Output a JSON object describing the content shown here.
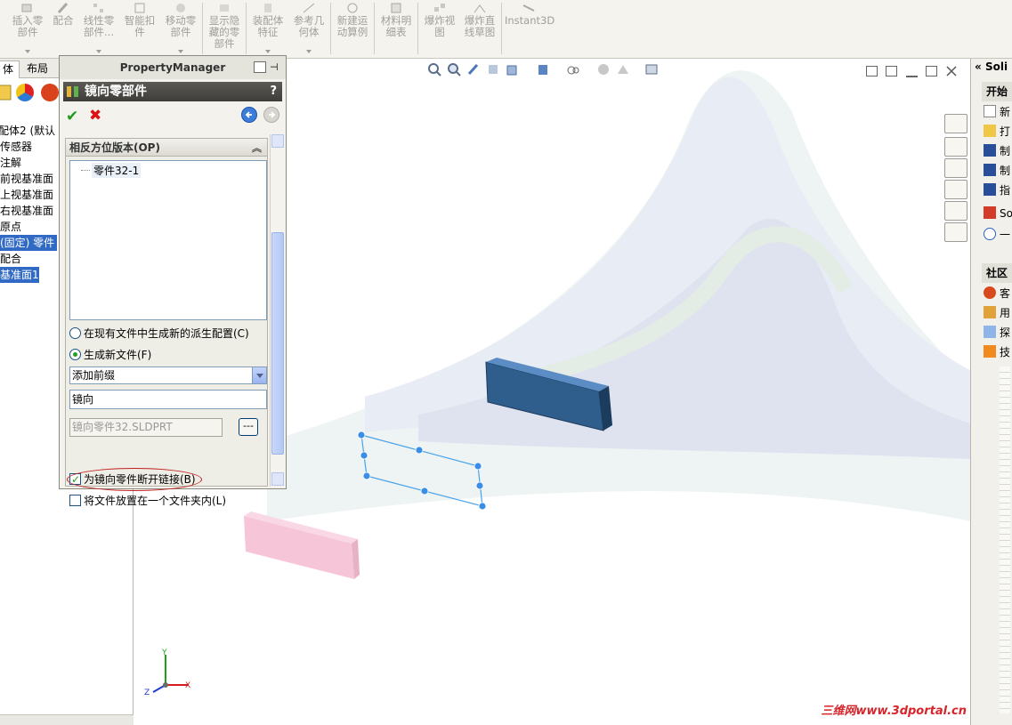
{
  "toolbar": {
    "buttons": [
      {
        "label": "插入零部件"
      },
      {
        "label": "配合"
      },
      {
        "label": "线性零部件..."
      },
      {
        "label": "智能扣件"
      },
      {
        "label": "移动零部件"
      },
      {
        "label": "显示隐藏的零部件"
      },
      {
        "label": "装配体特征"
      },
      {
        "label": "参考几何体"
      },
      {
        "label": "新建运动算例"
      },
      {
        "label": "材料明细表"
      },
      {
        "label": "爆炸视图"
      },
      {
        "label": "爆炸直线草图"
      },
      {
        "label": "Instant3D"
      }
    ]
  },
  "feature_manager": {
    "tabs": [
      "体",
      "布局"
    ],
    "tree": [
      "配体2 (默认",
      "传感器",
      "注解",
      "前视基准面",
      "上视基准面",
      "右视基准面",
      "原点",
      "(固定) 零件",
      "配合",
      "基准面1"
    ]
  },
  "property_manager": {
    "header": "PropertyManager",
    "title": "镜向零部件",
    "help": "?",
    "group_title": "相反方位版本(OP)",
    "list_items": [
      "零件32-1"
    ],
    "radio_existing": "在现有文件中生成新的派生配置(C)",
    "radio_new": "生成新文件(F)",
    "prefix_select": "添加前缀",
    "prefix_value": "镜向",
    "filename": "镜向零件32.SLDPRT",
    "browse": "---",
    "check_break_link": "为镜向零件断开链接(B)",
    "check_folder": "将文件放置在一个文件夹内(L)"
  },
  "taskpane": {
    "header": "Soli",
    "start_section": "开始",
    "start_items": [
      "新",
      "打",
      "制",
      "制",
      "指",
      "So",
      "一"
    ],
    "community_section": "社区",
    "community_items": [
      "客",
      "用",
      "探",
      "技"
    ]
  },
  "triad": {
    "x": "X",
    "y": "Y",
    "z": "Z"
  },
  "watermark": "三维网www.3dportal.cn"
}
